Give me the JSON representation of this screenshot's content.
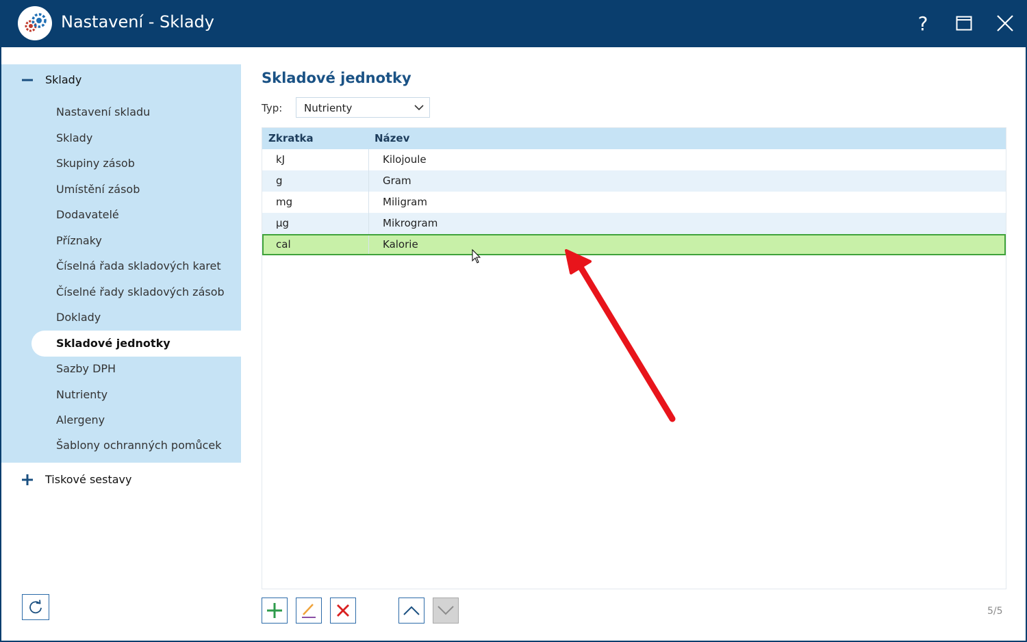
{
  "window": {
    "title": "Nastavení - Sklady",
    "help_glyph": "?",
    "accent": "#0a3e6e"
  },
  "sidebar": {
    "group1": {
      "label": "Sklady",
      "toggle": "minus"
    },
    "items": [
      {
        "label": "Nastavení skladu"
      },
      {
        "label": "Sklady"
      },
      {
        "label": "Skupiny zásob"
      },
      {
        "label": "Umístění zásob"
      },
      {
        "label": "Dodavatelé"
      },
      {
        "label": "Příznaky"
      },
      {
        "label": "Číselná řada skladových karet"
      },
      {
        "label": "Číselné řady skladových zásob"
      },
      {
        "label": "Doklady"
      },
      {
        "label": "Skladové jednotky",
        "active": true
      },
      {
        "label": "Sazby DPH"
      },
      {
        "label": "Nutrienty"
      },
      {
        "label": "Alergeny"
      },
      {
        "label": "Šablony ochranných pomůcek"
      }
    ],
    "group2": {
      "label": "Tiskové sestavy",
      "toggle": "plus"
    },
    "panel_color": "#c6e3f5"
  },
  "main": {
    "title": "Skladové jednotky",
    "filter": {
      "label": "Typ:",
      "value": "Nutrienty"
    },
    "table": {
      "columns": [
        "Zkratka",
        "Název"
      ],
      "rows": [
        [
          "kJ",
          "Kilojoule"
        ],
        [
          "g",
          "Gram"
        ],
        [
          "mg",
          "Miligram"
        ],
        [
          "µg",
          "Mikrogram"
        ],
        [
          "cal",
          "Kalorie"
        ]
      ],
      "selected_index": 4,
      "selected_color": "#c8f0a8"
    },
    "toolbar": {
      "buttons": [
        "add-icon",
        "edit-icon",
        "delete-icon",
        "move-up-icon",
        "move-down-icon"
      ]
    },
    "counter": "5/5"
  },
  "annotation": {
    "arrow_color": "#e8141b"
  }
}
